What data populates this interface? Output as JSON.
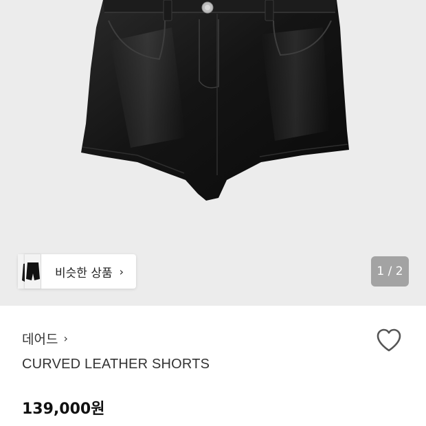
{
  "product_gallery": {
    "image_alt": "black leather shorts",
    "similar_items_label": "비슷한 상품",
    "similar_items_arrow": "›",
    "page_indicator": "1 / 2"
  },
  "product_info": {
    "brand": "데어드",
    "brand_arrow": "›",
    "name": "CURVED LEATHER SHORTS",
    "price": "139,000원",
    "wishlist_icon": "heart-outline-icon"
  }
}
